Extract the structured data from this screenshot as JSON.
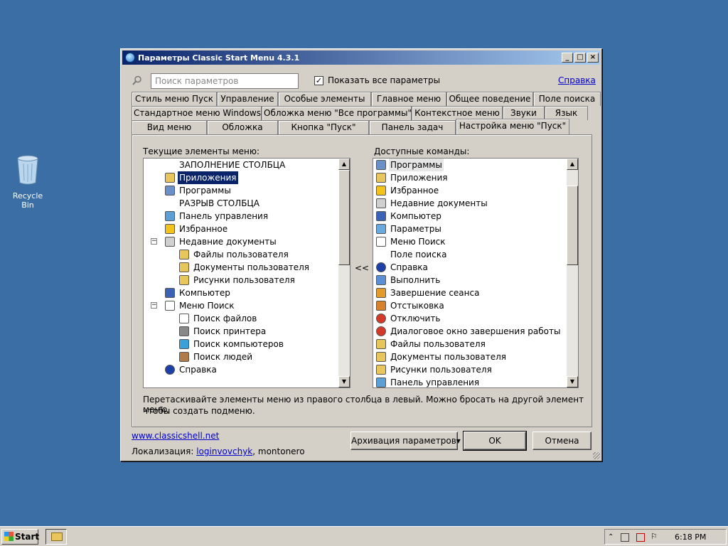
{
  "desktop": {
    "recycle_bin_label": "Recycle Bin"
  },
  "window": {
    "title": "Параметры Classic Start Menu 4.3.1",
    "buttons": {
      "minimize": "_",
      "maximize": "□",
      "close": "×"
    },
    "search_placeholder": "Поиск параметров",
    "show_all_label": "Показать все параметры",
    "show_all_checked": true,
    "help_link": "Справка",
    "tabs_row1": [
      "Стиль меню Пуск",
      "Управление",
      "Особые элементы",
      "Главное меню",
      "Общее поведение",
      "Поле поиска"
    ],
    "tabs_row2": [
      "Стандартное меню Windows",
      "Обложка меню \"Все программы\"",
      "Контекстное меню",
      "Звуки",
      "Язык"
    ],
    "tabs_row3": [
      "Вид меню",
      "Обложка",
      "Кнопка \"Пуск\"",
      "Панель задач",
      "Настройка меню \"Пуск\""
    ],
    "active_tab": "Настройка меню \"Пуск\"",
    "current_label": "Текущие элементы меню:",
    "available_label": "Доступные команды:",
    "current_items": [
      {
        "text": "ЗАПОЛНЕНИЕ СТОЛБЦА",
        "level": 0,
        "icon": "none"
      },
      {
        "text": "Приложения",
        "level": 0,
        "icon": "folder-icon",
        "selected": true
      },
      {
        "text": "Программы",
        "level": 0,
        "icon": "programs-icon"
      },
      {
        "text": "РАЗРЫВ СТОЛБЦА",
        "level": 0,
        "icon": "none"
      },
      {
        "text": "Панель управления",
        "level": 0,
        "icon": "control-panel-icon"
      },
      {
        "text": "Избранное",
        "level": 0,
        "icon": "star-icon"
      },
      {
        "text": "Недавние документы",
        "level": 0,
        "icon": "documents-icon",
        "expander": "−"
      },
      {
        "text": "Файлы пользователя",
        "level": 1,
        "icon": "folder-icon"
      },
      {
        "text": "Документы пользователя",
        "level": 1,
        "icon": "folder-icon"
      },
      {
        "text": "Рисунки пользователя",
        "level": 1,
        "icon": "folder-icon"
      },
      {
        "text": "Компьютер",
        "level": 0,
        "icon": "computer-icon"
      },
      {
        "text": "Меню Поиск",
        "level": 0,
        "icon": "search-icon",
        "expander": "−"
      },
      {
        "text": "Поиск файлов",
        "level": 1,
        "icon": "search-icon"
      },
      {
        "text": "Поиск принтера",
        "level": 1,
        "icon": "printer-icon"
      },
      {
        "text": "Поиск компьютеров",
        "level": 1,
        "icon": "globe-icon"
      },
      {
        "text": "Поиск людей",
        "level": 1,
        "icon": "people-icon"
      },
      {
        "text": "Справка",
        "level": 0,
        "icon": "help-icon"
      }
    ],
    "move_button": "<<",
    "available_items": [
      {
        "text": "Программы",
        "icon": "programs-icon",
        "highlighted": true
      },
      {
        "text": "Приложения",
        "icon": "folder-icon"
      },
      {
        "text": "Избранное",
        "icon": "star-icon"
      },
      {
        "text": "Недавние документы",
        "icon": "documents-icon"
      },
      {
        "text": "Компьютер",
        "icon": "computer-icon"
      },
      {
        "text": "Параметры",
        "icon": "settings-icon"
      },
      {
        "text": "Меню Поиск",
        "icon": "search-icon"
      },
      {
        "text": "Поле поиска",
        "icon": "none"
      },
      {
        "text": "Справка",
        "icon": "help-icon"
      },
      {
        "text": "Выполнить",
        "icon": "run-icon"
      },
      {
        "text": "Завершение сеанса",
        "icon": "logoff-icon"
      },
      {
        "text": "Отстыковка",
        "icon": "undock-icon"
      },
      {
        "text": "Отключить",
        "icon": "power-icon"
      },
      {
        "text": "Диалоговое окно завершения работы",
        "icon": "power-icon"
      },
      {
        "text": "Файлы пользователя",
        "icon": "folder-icon"
      },
      {
        "text": "Документы пользователя",
        "icon": "folder-icon"
      },
      {
        "text": "Рисунки пользователя",
        "icon": "folder-icon"
      },
      {
        "text": "Панель управления",
        "icon": "control-panel-icon"
      }
    ],
    "hint_line1": "Перетаскивайте элементы меню из правого столбца в левый. Можно бросать на другой элемент меню,",
    "hint_line2": "чтобы создать подменю.",
    "site_link": "www.classicshell.net",
    "localization_prefix": "Локализация: ",
    "localization_link": "loginvovchyk",
    "localization_suffix": ", montonero",
    "backup_button": "Архивация параметров▾",
    "ok_button": "OK",
    "cancel_button": "Отмена"
  },
  "taskbar": {
    "start_label": "Start",
    "clock": "6:18 PM"
  },
  "colors": {
    "desktop": "#3a6ea5",
    "title_start": "#0a246a",
    "title_end": "#a6caf0",
    "selection": "#0a246a"
  }
}
